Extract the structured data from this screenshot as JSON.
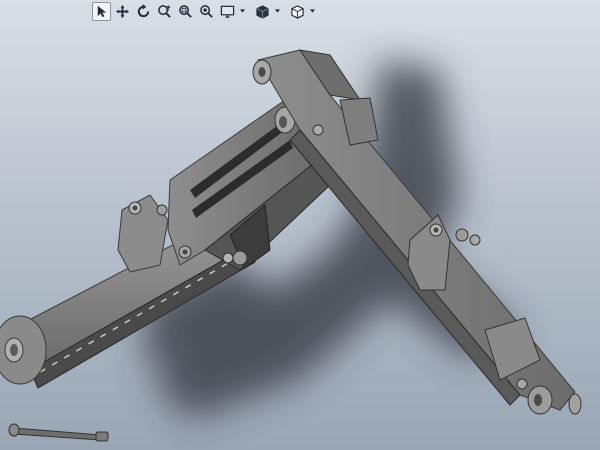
{
  "toolbar": {
    "items": [
      {
        "icon": "select-pointer-icon",
        "active": true
      },
      {
        "icon": "pan-move-icon"
      },
      {
        "icon": "rotate-view-icon"
      },
      {
        "icon": "zoom-in-out-icon"
      },
      {
        "icon": "zoom-to-area-icon"
      },
      {
        "icon": "zoom-to-fit-icon"
      },
      {
        "icon": "display-monitor-icon",
        "dropdown": true
      },
      {
        "icon": "display-style-icon",
        "dropdown": true
      },
      {
        "icon": "view-orientation-cube-icon",
        "dropdown": true
      }
    ]
  },
  "colors": {
    "background_top": "#d9dfe6",
    "background_bottom": "#9aa6b4",
    "part_gray": "#7a7a7a",
    "part_dark": "#4a4a4a",
    "part_light": "#9a9a9a",
    "shadow": "#3a3f48",
    "active_button": "#f2f4f7"
  }
}
